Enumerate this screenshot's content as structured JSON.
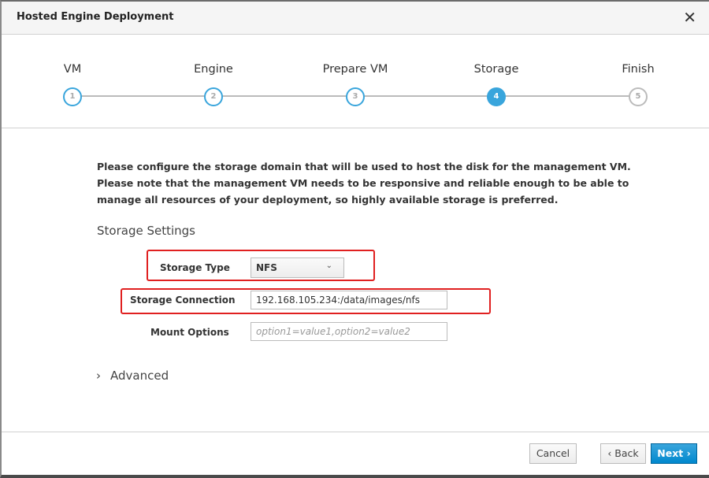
{
  "dialog": {
    "title": "Hosted Engine Deployment",
    "close_icon": "close-icon"
  },
  "steps": [
    {
      "number": "1",
      "label": "VM",
      "state": "completed"
    },
    {
      "number": "2",
      "label": "Engine",
      "state": "completed"
    },
    {
      "number": "3",
      "label": "Prepare VM",
      "state": "completed"
    },
    {
      "number": "4",
      "label": "Storage",
      "state": "active"
    },
    {
      "number": "5",
      "label": "Finish",
      "state": "future"
    }
  ],
  "main": {
    "description": "Please configure the storage domain that will be used to host the disk for the management VM. Please note that the management VM needs to be responsive and reliable enough to be able to manage all resources of your deployment, so highly available storage is preferred.",
    "section_title": "Storage Settings",
    "storage_type": {
      "label": "Storage Type",
      "value": "NFS"
    },
    "storage_connection": {
      "label": "Storage Connection",
      "value": "192.168.105.234:/data/images/nfs"
    },
    "mount_options": {
      "label": "Mount Options",
      "value": "",
      "placeholder": "option1=value1,option2=value2"
    },
    "advanced_label": "Advanced"
  },
  "footer": {
    "cancel": "Cancel",
    "back": "‹ Back",
    "next": "Next ›"
  },
  "colors": {
    "accent": "#39a5dc",
    "highlight": "#e02020"
  }
}
